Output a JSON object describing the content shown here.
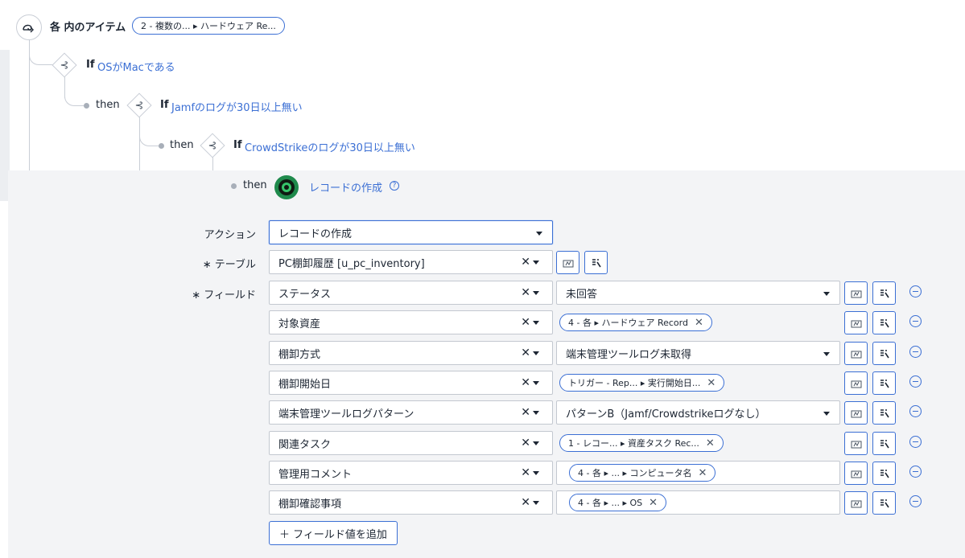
{
  "flow": {
    "for_each": {
      "label": "各 内のアイテム",
      "pill": "2 - 複数の... ▸ ハードウェア Re..."
    },
    "conditions": [
      {
        "keyword": "If",
        "text": "OSがMacである"
      },
      {
        "keyword": "If",
        "text": "Jamfのログが30日以上無い",
        "then": "then"
      },
      {
        "keyword": "If",
        "text": "CrowdStrikeのログが30日以上無い",
        "then": "then"
      }
    ],
    "action_step": {
      "then": "then",
      "title": "レコードの作成",
      "help_icon": "help-icon"
    }
  },
  "form": {
    "action_label": "アクション",
    "action_value": "レコードの作成",
    "table_label": "∗ テーブル",
    "table_value": "PC棚卸履歴 [u_pc_inventory]",
    "fields_label": "∗ フィールド",
    "rows": [
      {
        "field": "ステータス",
        "kind": "select",
        "value": "未回答"
      },
      {
        "field": "対象資産",
        "kind": "pill",
        "value": "4 - 各 ▸ ハードウェア Record"
      },
      {
        "field": "棚卸方式",
        "kind": "select",
        "value": "端末管理ツールログ未取得"
      },
      {
        "field": "棚卸開始日",
        "kind": "pill",
        "value": "トリガー - Rep... ▸ 実行開始日..."
      },
      {
        "field": "端末管理ツールログパターン",
        "kind": "select",
        "value": "パターンB（Jamf/Crowdstrikeログなし）"
      },
      {
        "field": "関連タスク",
        "kind": "pill",
        "value": "1 - レコー... ▸ 資産タスク Rec..."
      },
      {
        "field": "管理用コメント",
        "kind": "boxpill",
        "value": "4 - 各 ▸ ... ▸ コンピュータ名"
      },
      {
        "field": "棚卸確認事項",
        "kind": "boxpill",
        "value": "4 - 各 ▸ ... ▸ OS"
      }
    ],
    "add_button": "＋ フィールド値を追加"
  },
  "colors": {
    "accent": "#3b6fd4",
    "action_icon_ring": "#1f8a4c",
    "panel_bg": "#f3f4f6"
  }
}
